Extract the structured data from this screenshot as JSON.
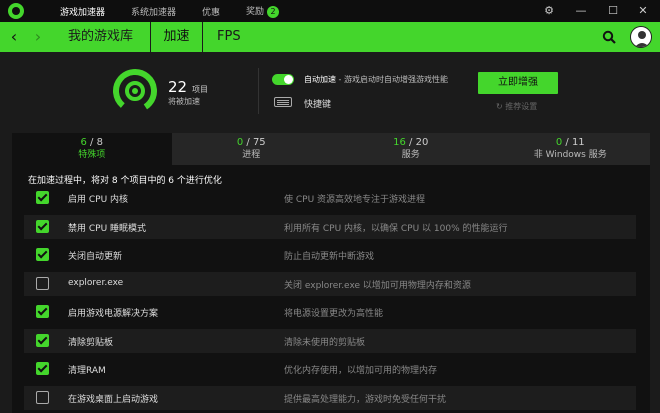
{
  "titlebar": {
    "tabs": [
      {
        "label": "游戏加速器",
        "active": true
      },
      {
        "label": "系统加速器",
        "active": false
      },
      {
        "label": "优惠",
        "active": false
      },
      {
        "label": "奖励",
        "active": false,
        "badge": "2"
      }
    ],
    "controls": {
      "settings": "⚙",
      "minimize": "—",
      "maximize": "☐",
      "close": "✕"
    }
  },
  "navbar": {
    "back": "‹",
    "forward": "›",
    "tabs": [
      {
        "label": "我的游戏库",
        "active": false
      },
      {
        "label": "加速",
        "active": true
      },
      {
        "label": "FPS",
        "active": false
      }
    ]
  },
  "summary": {
    "count": "22",
    "unit": "项目",
    "subtitle": "将被加速",
    "auto_boost": {
      "label": "自动加速",
      "description": " - 游戏启动时自动增强游戏性能",
      "enabled": true
    },
    "shortcut_label": "快捷键",
    "boost_button": "立即增强",
    "restore_label": "推荐设置"
  },
  "categories": [
    {
      "count": "6",
      "total": "8",
      "label": "特殊项",
      "active": true
    },
    {
      "count": "0",
      "total": "75",
      "label": "进程",
      "active": false
    },
    {
      "count": "16",
      "total": "20",
      "label": "服务",
      "active": false
    },
    {
      "count": "0",
      "total": "11",
      "label": "非 Windows 服务",
      "active": false
    }
  ],
  "list": {
    "header": "在加速过程中，将对 8 个项目中的 6 个进行优化",
    "rows": [
      {
        "name": "启用 CPU 内核",
        "description": "使 CPU 资源高效地专注于游戏进程",
        "checked": true
      },
      {
        "name": "禁用 CPU 睡眠模式",
        "description": "利用所有 CPU 内核，以确保 CPU 以 100% 的性能运行",
        "checked": true
      },
      {
        "name": "关闭自动更新",
        "description": "防止自动更新中断游戏",
        "checked": true
      },
      {
        "name": "explorer.exe",
        "description": "关闭 explorer.exe 以增加可用物理内存和资源",
        "checked": false
      },
      {
        "name": "启用游戏电源解决方案",
        "description": "将电源设置更改为高性能",
        "checked": true
      },
      {
        "name": "清除剪贴板",
        "description": "清除未使用的剪贴板",
        "checked": true
      },
      {
        "name": "清理RAM",
        "description": "优化内存使用，以增加可用的物理内存",
        "checked": true
      },
      {
        "name": "在游戏桌面上启动游戏",
        "description": "提供最高处理能力，游戏时免受任何干扰",
        "checked": false
      }
    ]
  },
  "colors": {
    "accent": "#44d62c",
    "background": "#1b1b1b",
    "panel": "#111111"
  }
}
